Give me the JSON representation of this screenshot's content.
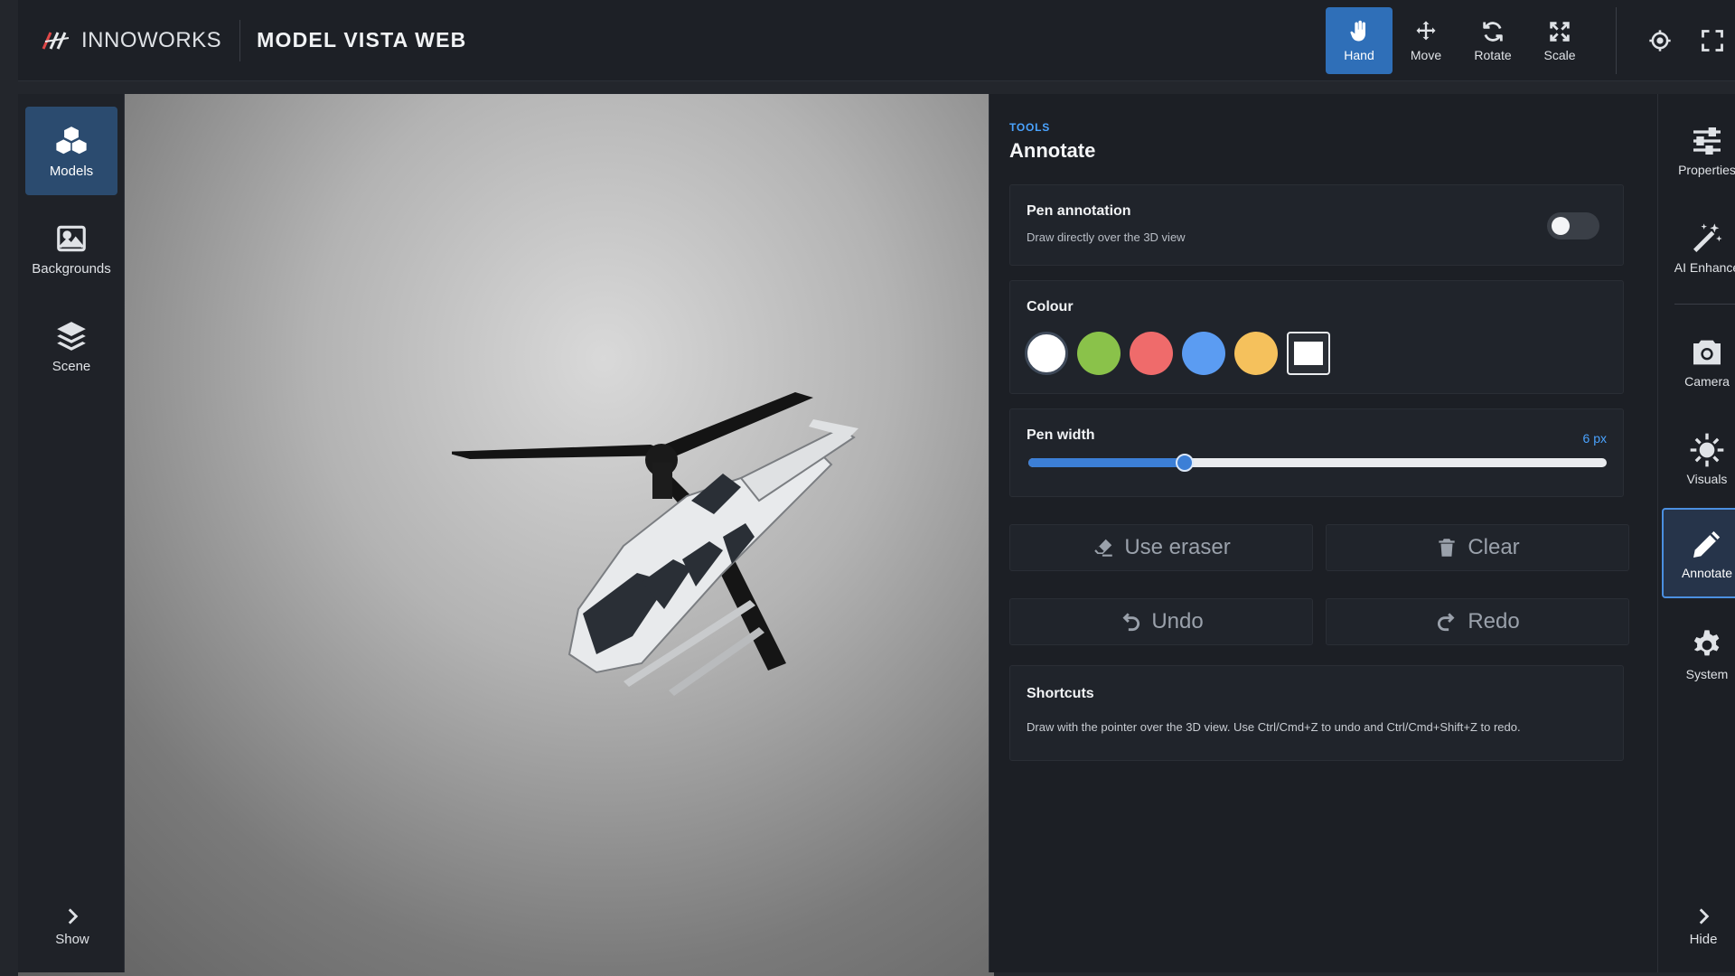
{
  "header": {
    "brand": "INNOWORKS",
    "app_title": "MODEL VISTA WEB",
    "tools": [
      {
        "label": "Hand",
        "icon": "hand-icon",
        "active": true
      },
      {
        "label": "Move",
        "icon": "move-icon",
        "active": false
      },
      {
        "label": "Rotate",
        "icon": "rotate-icon",
        "active": false
      },
      {
        "label": "Scale",
        "icon": "scale-icon",
        "active": false
      }
    ],
    "extra_icons": [
      "crosshair-icon",
      "fullscreen-icon"
    ]
  },
  "left_nav": {
    "items": [
      {
        "label": "Models",
        "icon": "cubes-icon",
        "active": true
      },
      {
        "label": "Backgrounds",
        "icon": "image-icon",
        "active": false
      },
      {
        "label": "Scene",
        "icon": "layers-icon",
        "active": false
      }
    ],
    "show_label": "Show"
  },
  "panel": {
    "eyebrow": "TOOLS",
    "title": "Annotate",
    "pen_annotation": {
      "title": "Pen annotation",
      "subtitle": "Draw directly over the 3D view",
      "enabled": false
    },
    "colour": {
      "title": "Colour",
      "swatches": [
        "#ffffff",
        "#8ac24a",
        "#ef6b6b",
        "#5b9cf2",
        "#f5c15c",
        "#ffffff"
      ],
      "selected_index": 0
    },
    "pen_width": {
      "title": "Pen width",
      "value_label": "6 px",
      "fraction": 0.27
    },
    "buttons": {
      "eraser": "Use eraser",
      "clear": "Clear",
      "undo": "Undo",
      "redo": "Redo"
    },
    "shortcuts": {
      "title": "Shortcuts",
      "text": "Draw with the pointer over the 3D view. Use Ctrl/Cmd+Z to undo and Ctrl/Cmd+Shift+Z to redo."
    }
  },
  "right_nav": {
    "items": [
      {
        "label": "Properties",
        "icon": "sliders-icon",
        "active": false
      },
      {
        "label": "AI Enhance",
        "icon": "magic-wand-icon",
        "active": false
      },
      {
        "label": "Camera",
        "icon": "camera-icon",
        "active": false
      },
      {
        "label": "Visuals",
        "icon": "sun-icon",
        "active": false
      },
      {
        "label": "Annotate",
        "icon": "pencil-icon",
        "active": true
      },
      {
        "label": "System",
        "icon": "gear-icon",
        "active": false
      }
    ],
    "hide_label": "Hide"
  },
  "colors": {
    "accent": "#2f6fb8",
    "accent_text": "#4aa3ff",
    "panel_bg": "#1c1f25"
  }
}
